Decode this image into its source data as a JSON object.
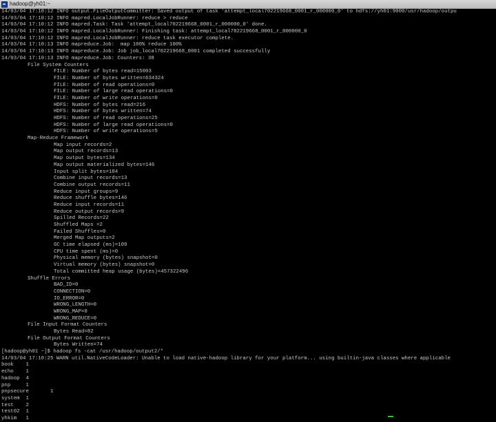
{
  "window": {
    "title": "hadoop@yh01:~"
  },
  "terminal": {
    "lines": [
      {
        "indent": 0,
        "text": "14/03/04 17:10:12 INFO output.FileOutputCommitter: Saved output of task 'attempt_local702219668_0001_r_000000_0' to hdfs://yh01:9000/usr/hadoop/outpu"
      },
      {
        "indent": 0,
        "text": "14/03/04 17:10:12 INFO mapred.LocalJobRunner: reduce > reduce"
      },
      {
        "indent": 0,
        "text": "14/03/04 17:10:12 INFO mapred.Task: Task 'attempt_local702219668_0001_r_000000_0' done."
      },
      {
        "indent": 0,
        "text": "14/03/04 17:10:12 INFO mapred.LocalJobRunner: Finishing task: attempt_local702219668_0001_r_000000_0"
      },
      {
        "indent": 0,
        "text": "14/03/04 17:10:12 INFO mapred.LocalJobRunner: reduce task executor complete."
      },
      {
        "indent": 0,
        "text": "14/03/04 17:10:13 INFO mapreduce.Job:  map 100% reduce 100%"
      },
      {
        "indent": 0,
        "text": "14/03/04 17:10:13 INFO mapreduce.Job: Job job_local702219668_0001 completed successfully"
      },
      {
        "indent": 0,
        "text": "14/03/04 17:10:13 INFO mapreduce.Job: Counters: 38"
      },
      {
        "indent": 1,
        "text": "File System Counters"
      },
      {
        "indent": 2,
        "text": "FILE: Number of bytes read=15003"
      },
      {
        "indent": 2,
        "text": "FILE: Number of bytes written=634324"
      },
      {
        "indent": 2,
        "text": "FILE: Number of read operations=0"
      },
      {
        "indent": 2,
        "text": "FILE: Number of large read operations=0"
      },
      {
        "indent": 2,
        "text": "FILE: Number of write operations=0"
      },
      {
        "indent": 2,
        "text": "HDFS: Number of bytes read=216"
      },
      {
        "indent": 2,
        "text": "HDFS: Number of bytes written=74"
      },
      {
        "indent": 2,
        "text": "HDFS: Number of read operations=25"
      },
      {
        "indent": 2,
        "text": "HDFS: Number of large read operations=0"
      },
      {
        "indent": 2,
        "text": "HDFS: Number of write operations=5"
      },
      {
        "indent": 1,
        "text": "Map-Reduce Framework"
      },
      {
        "indent": 2,
        "text": "Map input records=2"
      },
      {
        "indent": 2,
        "text": "Map output records=13"
      },
      {
        "indent": 2,
        "text": "Map output bytes=134"
      },
      {
        "indent": 2,
        "text": "Map output materialized bytes=146"
      },
      {
        "indent": 2,
        "text": "Input split bytes=184"
      },
      {
        "indent": 2,
        "text": "Combine input records=13"
      },
      {
        "indent": 2,
        "text": "Combine output records=11"
      },
      {
        "indent": 2,
        "text": "Reduce input groups=9"
      },
      {
        "indent": 2,
        "text": "Reduce shuffle bytes=146"
      },
      {
        "indent": 2,
        "text": "Reduce input records=11"
      },
      {
        "indent": 2,
        "text": "Reduce output records=9"
      },
      {
        "indent": 2,
        "text": "Spilled Records=22"
      },
      {
        "indent": 2,
        "text": "Shuffled Maps =2"
      },
      {
        "indent": 2,
        "text": "Failed Shuffles=0"
      },
      {
        "indent": 2,
        "text": "Merged Map outputs=2"
      },
      {
        "indent": 2,
        "text": "GC time elapsed (ms)=109"
      },
      {
        "indent": 2,
        "text": "CPU time spent (ms)=0"
      },
      {
        "indent": 2,
        "text": "Physical memory (bytes) snapshot=0"
      },
      {
        "indent": 2,
        "text": "Virtual memory (bytes) snapshot=0"
      },
      {
        "indent": 2,
        "text": "Total committed heap usage (bytes)=457322496"
      },
      {
        "indent": 1,
        "text": "Shuffle Errors"
      },
      {
        "indent": 2,
        "text": "BAD_ID=0"
      },
      {
        "indent": 2,
        "text": "CONNECTION=0"
      },
      {
        "indent": 2,
        "text": "IO_ERROR=0"
      },
      {
        "indent": 2,
        "text": "WRONG_LENGTH=0"
      },
      {
        "indent": 2,
        "text": "WRONG_MAP=0"
      },
      {
        "indent": 2,
        "text": "WRONG_REDUCE=0"
      },
      {
        "indent": 1,
        "text": "File Input Format Counters"
      },
      {
        "indent": 2,
        "text": "Bytes Read=82"
      },
      {
        "indent": 1,
        "text": "File Output Format Counters"
      },
      {
        "indent": 2,
        "text": "Bytes Written=74"
      },
      {
        "indent": 0,
        "text": "[hadoop@yh01 ~]$ hadoop fs -cat /usr/hadoop/output2/*"
      },
      {
        "indent": 0,
        "text": "14/03/04 17:10:25 WARN util.NativeCodeLoader: Unable to load native-hadoop library for your platform... using builtin-java classes where applicable"
      },
      {
        "indent": 0,
        "text": "book    1"
      },
      {
        "indent": 0,
        "text": "echo    1"
      },
      {
        "indent": 0,
        "text": "hadoop  4"
      },
      {
        "indent": 0,
        "text": "pnp     1"
      },
      {
        "indent": 0,
        "text": "pnpsecure       1"
      },
      {
        "indent": 0,
        "text": "system  1"
      },
      {
        "indent": 0,
        "text": "test    2"
      },
      {
        "indent": 0,
        "text": "test02  1"
      },
      {
        "indent": 0,
        "text": "yhkim   1"
      }
    ]
  },
  "colors": {
    "background": "#000000",
    "text": "#c8c8c8",
    "titlebar": "#d0d0d0",
    "cursor_mark": "#3cbf3c"
  }
}
